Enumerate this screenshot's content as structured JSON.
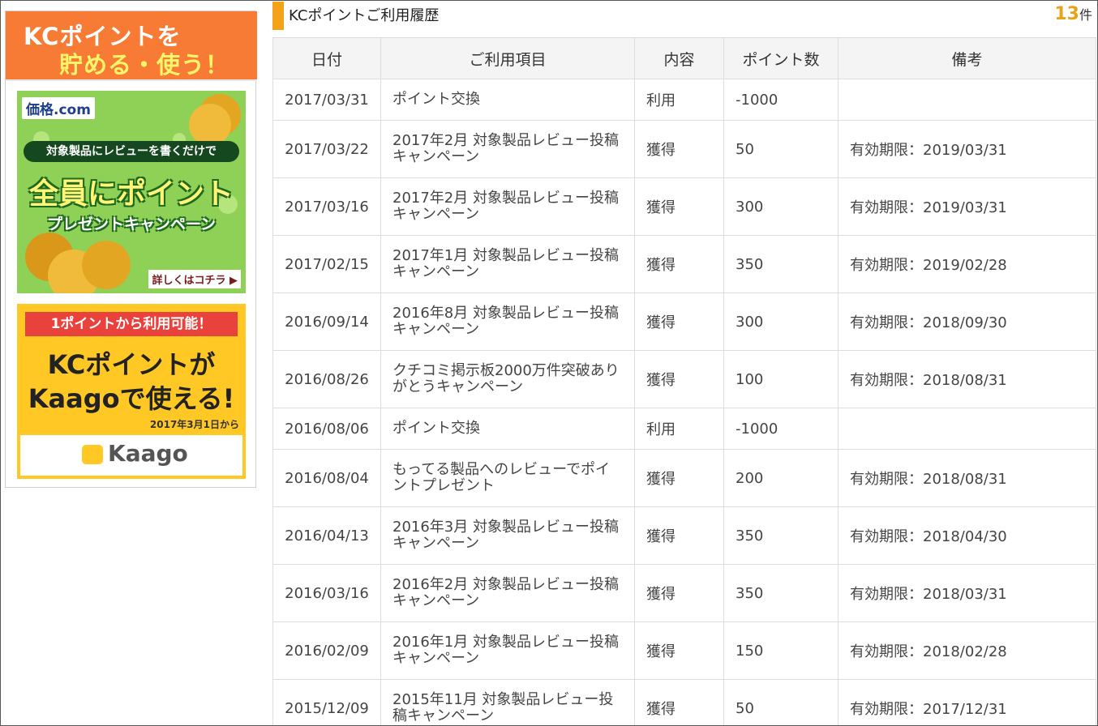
{
  "sidebar": {
    "header_line1": "KCポイントを",
    "header_line2": "貯める・使う！",
    "banner1": {
      "logo": "価格.com",
      "ribbon": "対象製品にレビューを書くだけで",
      "main": "全員にポイント",
      "sub": "プレゼントキャンペーン",
      "more": "詳しくはコチラ ▶"
    },
    "banner2": {
      "ribbon": "1ポイントから利用可能！",
      "line1": "KCポイントが",
      "line2": "Kaagoで使える!",
      "date": "2017年3月1日から",
      "logo": "Kaago"
    }
  },
  "main": {
    "title": "KCポイントご利用履歴",
    "count_number": "13",
    "count_unit": "件"
  },
  "table": {
    "headers": [
      "日付",
      "ご利用項目",
      "内容",
      "ポイント数",
      "備考"
    ],
    "rows": [
      {
        "date": "2017/03/31",
        "item": "ポイント交換",
        "type": "利用",
        "points": "-1000",
        "note": "",
        "multi": false
      },
      {
        "date": "2017/03/22",
        "item": "2017年2月 対象製品レビュー投稿キャンペーン",
        "type": "獲得",
        "points": "50",
        "note": "有効期限：2019/03/31",
        "multi": true
      },
      {
        "date": "2017/03/16",
        "item": "2017年2月 対象製品レビュー投稿キャンペーン",
        "type": "獲得",
        "points": "300",
        "note": "有効期限：2019/03/31",
        "multi": true
      },
      {
        "date": "2017/02/15",
        "item": "2017年1月 対象製品レビュー投稿キャンペーン",
        "type": "獲得",
        "points": "350",
        "note": "有効期限：2019/02/28",
        "multi": true
      },
      {
        "date": "2016/09/14",
        "item": "2016年8月 対象製品レビュー投稿キャンペーン",
        "type": "獲得",
        "points": "300",
        "note": "有効期限：2018/09/30",
        "multi": true
      },
      {
        "date": "2016/08/26",
        "item": "クチコミ掲示板2000万件突破ありがとうキャンペーン",
        "type": "獲得",
        "points": "100",
        "note": "有効期限：2018/08/31",
        "multi": true
      },
      {
        "date": "2016/08/06",
        "item": "ポイント交換",
        "type": "利用",
        "points": "-1000",
        "note": "",
        "multi": false
      },
      {
        "date": "2016/08/04",
        "item": "もってる製品へのレビューでポイントプレゼント",
        "type": "獲得",
        "points": "200",
        "note": "有効期限：2018/08/31",
        "multi": true
      },
      {
        "date": "2016/04/13",
        "item": "2016年3月 対象製品レビュー投稿キャンペーン",
        "type": "獲得",
        "points": "350",
        "note": "有効期限：2018/04/30",
        "multi": true
      },
      {
        "date": "2016/03/16",
        "item": "2016年2月 対象製品レビュー投稿キャンペーン",
        "type": "獲得",
        "points": "350",
        "note": "有効期限：2018/03/31",
        "multi": true
      },
      {
        "date": "2016/02/09",
        "item": "2016年1月 対象製品レビュー投稿キャンペーン",
        "type": "獲得",
        "points": "150",
        "note": "有効期限：2018/02/28",
        "multi": true
      },
      {
        "date": "2015/12/09",
        "item": "2015年11月 対象製品レビュー投稿キャンペーン",
        "type": "獲得",
        "points": "50",
        "note": "有効期限：2017/12/31",
        "multi": true
      }
    ]
  }
}
